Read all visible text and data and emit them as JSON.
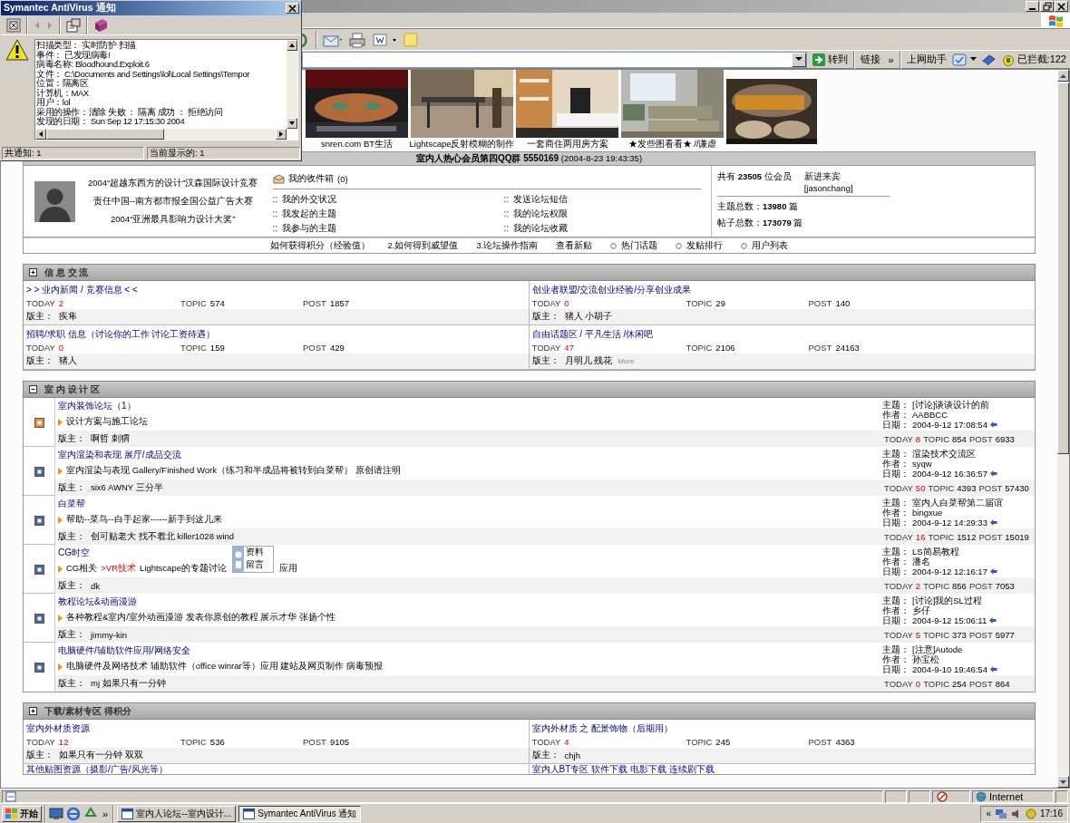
{
  "popup": {
    "title": "Symantec AntiVirus 通知",
    "lines": [
      "扫描类型： 实时防护 扫描",
      "事件： 已发现病毒!",
      "病毒名称: Bloodhound.Exploit.6",
      "文件： C:\\Documents and Settings\\lol\\Local Settings\\Tempor",
      "位置：隔离区",
      "计算机：MAX",
      "用户：lol",
      "采用的操作：清除 失败 ： 隔离 成功 ： 拒绝访问",
      "发现的日期： Sun Sep 12 17:15:30 2004"
    ],
    "status_total": "共通知: 1",
    "status_current": "当前显示的: 1"
  },
  "address_bar": {
    "go": "转到",
    "links": "链接",
    "more": "»",
    "assistant": "上网助手",
    "blocked": "已拦截:122"
  },
  "banner": [
    {
      "kind": "picture",
      "caption": "snren.com BT生活"
    },
    {
      "kind": "picture",
      "caption": "Lightscape反射模糊的制作"
    },
    {
      "kind": "picture",
      "caption": "一套商住两用房方案"
    },
    {
      "kind": "picture",
      "caption": "★发些图看看★ //谦虚"
    },
    {
      "kind": "picture"
    }
  ],
  "announcement": "**室内人热心会员第四QQ群 5550169** (2004-8-23 19:43:35)",
  "member_panel": {
    "awards": [
      "2004“超越东西方的设计”汉森国际设计竞赛",
      "责任中国--南方都市报全国公益广告大赛",
      "2004“亚洲最具影响力设计大奖”"
    ],
    "inbox": "我的收件箱",
    "inbox_count": "(0)",
    "links": [
      "我的外交状况",
      "发送论坛短信",
      "我发起的主题",
      "我的论坛权限",
      "我参与的主题",
      "我的论坛收藏"
    ],
    "members": "共有 **23505** 位会员",
    "newcomer_label": "新进来宾",
    "newcomer": "[jasonchang]",
    "topics": "主题总数：**13980** 篇",
    "posts": "帖子总数：**173079** 篇"
  },
  "nav_links": [
    {
      "label": "如何获得积分（经验值）",
      "kind": "plain"
    },
    {
      "label": "2.如何得到威望值",
      "kind": "plain"
    },
    {
      "label": "3.论坛操作指南",
      "kind": "plain"
    },
    {
      "label": "查看新贴",
      "kind": "plain"
    },
    {
      "label": "热门话题",
      "kind": "diamond"
    },
    {
      "label": "发贴排行",
      "kind": "diamond"
    },
    {
      "label": "用户列表",
      "kind": "diamond"
    }
  ],
  "sections": [
    {
      "title": "信 息 交 流",
      "expanded": false,
      "kind": "grid",
      "forums": [
        {
          "name": "> > 业内新闻 / 竞赛信息 < <",
          "stats": [
            {
              "kind": "today",
              "label": "TODAY",
              "value": "2"
            },
            {
              "kind": "total",
              "label": "TOPIC",
              "value": "574"
            },
            {
              "kind": "total",
              "label": "POST",
              "value": "1857"
            }
          ],
          "moderator_label": "版主：",
          "moderators": "疾隼"
        },
        {
          "name": "创业者联盟/交流创业经验/分享创业成果",
          "stats": [
            {
              "kind": "today",
              "label": "TODAY",
              "value": "0"
            },
            {
              "kind": "total",
              "label": "TOPIC",
              "value": "29"
            },
            {
              "kind": "total",
              "label": "POST",
              "value": "140"
            }
          ],
          "moderator_label": "版主：",
          "moderators": "猪人 小胡子"
        },
        {
          "name": "招聘/求职 信息（讨论你的工作 讨论工资待遇）",
          "stats": [
            {
              "kind": "today",
              "label": "TODAY",
              "value": "0"
            },
            {
              "kind": "total",
              "label": "TOPIC",
              "value": "159"
            },
            {
              "kind": "total",
              "label": "POST",
              "value": "429"
            }
          ],
          "moderator_label": "版主：",
          "moderators": "猪人"
        },
        {
          "name": "自由话题区 / 平凡生活 /休闲吧",
          "stats": [
            {
              "kind": "today",
              "label": "TODAY",
              "value": "47"
            },
            {
              "kind": "total",
              "label": "TOPIC",
              "value": "2106"
            },
            {
              "kind": "total",
              "label": "POST",
              "value": "24163"
            }
          ],
          "moderator_label": "版主：",
          "moderators": "月明儿 残花",
          "more": "More"
        }
      ]
    },
    {
      "title": "室 内 设 计 区",
      "expanded": true,
      "kind": "list",
      "forums": [
        {
          "name": "室内装饰论坛（1）",
          "has_new": true,
          "description": [
            {
              "text": "设计方案与施工论坛",
              "hot": false
            }
          ],
          "moderator_label": "版主：",
          "moderators": "啊哲 刺猬",
          "last_post": [
            {
              "label": "主题：",
              "value": "[讨论]谈谈设计的前"
            },
            {
              "label": "作者：",
              "value": "AABBCC"
            },
            {
              "label": "日期：",
              "value": "2004-9-12 17:08:54"
            }
          ],
          "stats": [
            {
              "kind": "today",
              "label": "TODAY",
              "value": "8"
            },
            {
              "kind": "total",
              "label": "TOPIC",
              "value": "854"
            },
            {
              "kind": "total",
              "label": "POST",
              "value": "6933"
            }
          ]
        },
        {
          "name": "室内渲染和表现 展厅/成品交流",
          "has_new": false,
          "description": [
            {
              "text": "室内渲染与表现 Gallery/Finished Work（练习和半成品将被转到白菜帮） 原创请注明",
              "hot": false
            }
          ],
          "moderator_label": "版主：",
          "moderators": "six6 AWNY 三分半",
          "last_post": [
            {
              "label": "主题：",
              "value": "渲染技术交流区"
            },
            {
              "label": "作者：",
              "value": "syqw"
            },
            {
              "label": "日期：",
              "value": "2004-9-12 16:36:57"
            }
          ],
          "stats": [
            {
              "kind": "today",
              "label": "TODAY",
              "value": "50"
            },
            {
              "kind": "total",
              "label": "TOPIC",
              "value": "4393"
            },
            {
              "kind": "total",
              "label": "POST",
              "value": "57430"
            }
          ]
        },
        {
          "name": "白菜帮",
          "has_new": false,
          "description": [
            {
              "text": "帮助--菜鸟--白手起家------新手到这儿来",
              "hot": false
            }
          ],
          "moderator_label": "版主：",
          "moderators": "创可贴老大 找不着北 killer1028 wind",
          "last_post": [
            {
              "label": "主题：",
              "value": "室内人白菜帮第二届谊"
            },
            {
              "label": "作者：",
              "value": "bingxue"
            },
            {
              "label": "日期：",
              "value": "2004-9-12 14:29:33"
            }
          ],
          "stats": [
            {
              "kind": "today",
              "label": "TODAY",
              "value": "16"
            },
            {
              "kind": "total",
              "label": "TOPIC",
              "value": "1512"
            },
            {
              "kind": "total",
              "label": "POST",
              "value": "15019"
            }
          ]
        },
        {
          "name": "CG时空",
          "has_new": false,
          "description": [
            {
              "text": "CG相关",
              "hot": false
            },
            {
              "text": ">VR技术",
              "hot": true
            },
            {
              "text": "Lightscape的专题讨论",
              "hot": false
            },
            {
              "text": "应用",
              "hot": false
            }
          ],
          "context_menu": [
            "资料",
            "留言"
          ],
          "moderator_label": "版主：",
          "moderators": "dk",
          "last_post": [
            {
              "label": "主题：",
              "value": "LS简易教程"
            },
            {
              "label": "作者：",
              "value": "潘名"
            },
            {
              "label": "日期：",
              "value": "2004-9-12 12:16:17"
            }
          ],
          "stats": [
            {
              "kind": "today",
              "label": "TODAY",
              "value": "2"
            },
            {
              "kind": "total",
              "label": "TOPIC",
              "value": "856"
            },
            {
              "kind": "total",
              "label": "POST",
              "value": "7053"
            }
          ]
        },
        {
          "name": "教程论坛&动画漫游",
          "has_new": false,
          "description": [
            {
              "text": "各种教程&室内/室外动画漫游 发表你原创的教程 展示才华 张扬个性",
              "hot": false
            }
          ],
          "moderator_label": "版主：",
          "moderators": "jimmy-kin",
          "last_post": [
            {
              "label": "主题：",
              "value": "[讨论]我的SL过程"
            },
            {
              "label": "作者：",
              "value": "乡仔"
            },
            {
              "label": "日期：",
              "value": "2004-9-12 15:06:11"
            }
          ],
          "stats": [
            {
              "kind": "today",
              "label": "TODAY",
              "value": "5"
            },
            {
              "kind": "total",
              "label": "TOPIC",
              "value": "373"
            },
            {
              "kind": "total",
              "label": "POST",
              "value": "5977"
            }
          ]
        },
        {
          "name": "电脑硬件/辅助软件应用/网络安全",
          "has_new": false,
          "description": [
            {
              "text": "电脑硬件及网络技术 辅助软件（office winrar等）应用 建站及网页制作 病毒预报",
              "hot": false
            }
          ],
          "moderator_label": "版主：",
          "moderators": "mj 如果只有一分钟",
          "last_post": [
            {
              "label": "主题：",
              "value": "[注意]Autode"
            },
            {
              "label": "作者：",
              "value": "孙宝松"
            },
            {
              "label": "日期：",
              "value": "2004-9-10 19:46:54"
            }
          ],
          "stats": [
            {
              "kind": "today",
              "label": "TODAY",
              "value": "0"
            },
            {
              "kind": "total",
              "label": "TOPIC",
              "value": "254"
            },
            {
              "kind": "total",
              "label": "POST",
              "value": "864"
            }
          ]
        }
      ]
    },
    {
      "title": "下载/素材专区 得积分",
      "expanded": false,
      "kind": "grid",
      "forums": [
        {
          "name": "室内外材质资源",
          "stats": [
            {
              "kind": "today",
              "label": "TODAY",
              "value": "12"
            },
            {
              "kind": "total",
              "label": "TOPIC",
              "value": "536"
            },
            {
              "kind": "total",
              "label": "POST",
              "value": "9105"
            }
          ],
          "moderator_label": "版主：",
          "moderators": "如果只有一分钟 双双"
        },
        {
          "name": "室内外材质 之 配景饰物（后期用）",
          "stats": [
            {
              "kind": "today",
              "label": "TODAY",
              "value": "4"
            },
            {
              "kind": "total",
              "label": "TOPIC",
              "value": "245"
            },
            {
              "kind": "total",
              "label": "POST",
              "value": "4363"
            }
          ],
          "moderator_label": "版主：",
          "moderators": "chjh"
        },
        {
          "name": "其他贴图资源（摄影/广告/风光等）"
        },
        {
          "name": "室内人BT专区 软件下载 电影下载 连续剧下载"
        }
      ]
    }
  ],
  "status_bar": {
    "zone": "Internet"
  },
  "taskbar": {
    "start": "开始",
    "more": "»",
    "tasks": [
      {
        "label": "室内人论坛--室内设计...",
        "selected": false
      },
      {
        "label": "Symantec AntiVirus 通知",
        "selected": true
      }
    ],
    "tray_more": "«",
    "clock": "17:16"
  }
}
